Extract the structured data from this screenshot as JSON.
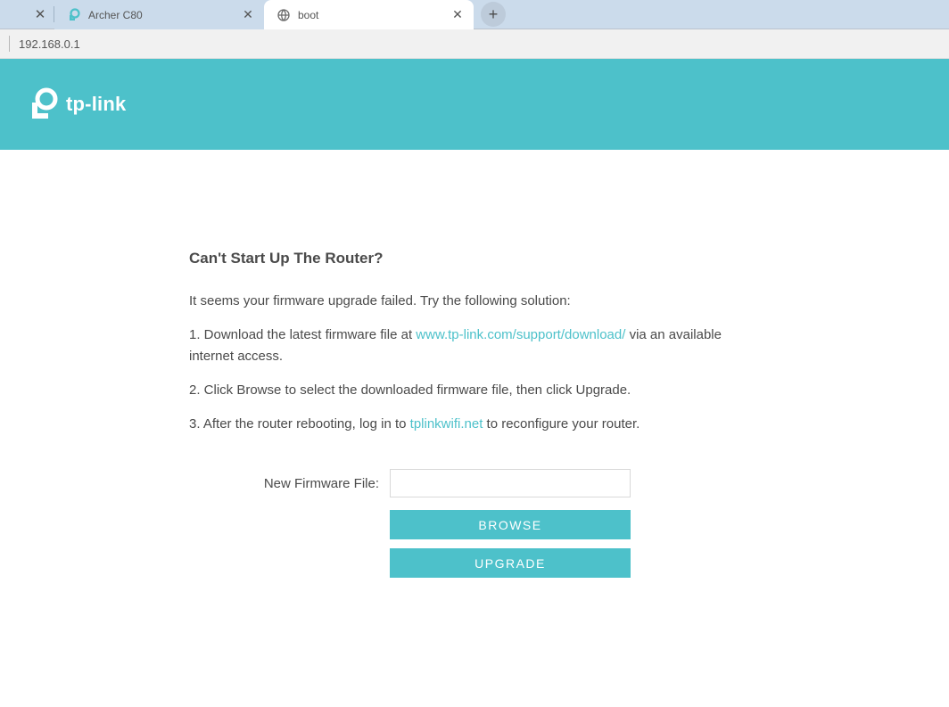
{
  "browser": {
    "tabs": [
      {
        "title": "Archer C80",
        "favicon": "tplink"
      },
      {
        "title": "boot",
        "favicon": "globe"
      }
    ],
    "active_tab_index": 1,
    "address": "192.168.0.1"
  },
  "header": {
    "brand": "tp-link"
  },
  "page": {
    "heading": "Can't Start Up The Router?",
    "intro": "It seems your firmware upgrade failed. Try the following solution:",
    "step1_a": "1. Download the latest firmware file at ",
    "step1_link": "www.tp-link.com/support/download/",
    "step1_b": " via an available internet access.",
    "step2": "2. Click Browse to select the downloaded firmware file, then click Upgrade.",
    "step3_a": "3. After the router rebooting, log in to ",
    "step3_link": "tplinkwifi.net",
    "step3_b": " to reconfigure your router.",
    "form": {
      "label": "New Firmware File:",
      "value": "",
      "browse": "BROWSE",
      "upgrade": "UPGRADE"
    }
  }
}
